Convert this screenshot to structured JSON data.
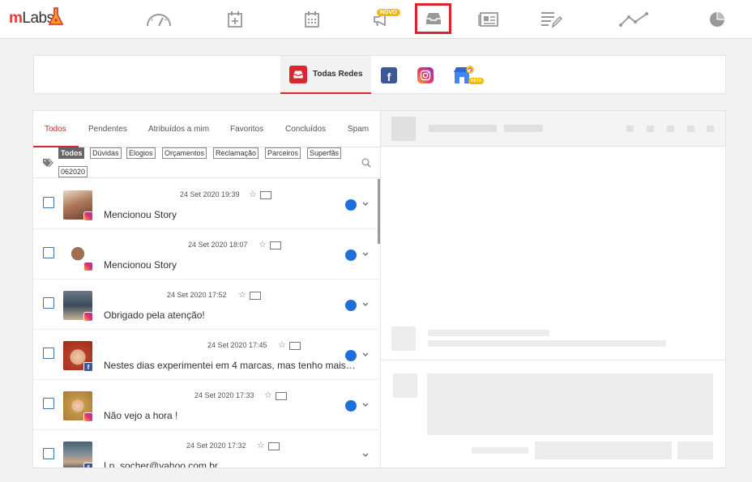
{
  "app": {
    "logo_m": "m",
    "logo_rest": "Labs"
  },
  "topnav": {
    "items": [
      {
        "name": "dashboard",
        "icon": "speedometer-icon"
      },
      {
        "name": "schedule",
        "icon": "calendar-plus-icon"
      },
      {
        "name": "calendar",
        "icon": "calendar-icon"
      },
      {
        "name": "ads",
        "icon": "megaphone-icon",
        "badge": "NOVO"
      },
      {
        "name": "inbox",
        "icon": "inbox-icon",
        "active": true
      },
      {
        "name": "reports",
        "icon": "newspaper-icon"
      },
      {
        "name": "workflow",
        "icon": "checklist-edit-icon"
      },
      {
        "name": "analytics",
        "icon": "line-chart-icon"
      },
      {
        "name": "pie",
        "icon": "pie-chart-icon"
      }
    ]
  },
  "networks": {
    "all_label": "Todas Redes",
    "beta_label": "BETA"
  },
  "tabs": [
    "Todos",
    "Pendentes",
    "Atribuídos a mim",
    "Favoritos",
    "Concluídos",
    "Spam"
  ],
  "filters": [
    "Todos",
    "Dúvidas",
    "Elogios",
    "Orçamentos",
    "Reclamação",
    "Parceiros",
    "Superfãs",
    "062020"
  ],
  "messages": [
    {
      "time": "24 Set 2020 19:39",
      "text": "Mencionou Story",
      "network": "instagram",
      "unread": true
    },
    {
      "time": "24 Set 2020 18:07",
      "text": "Mencionou Story",
      "network": "instagram",
      "unread": true
    },
    {
      "time": "24 Set 2020 17:52",
      "text": "Obrigado pela atenção!",
      "network": "instagram",
      "unread": true
    },
    {
      "time": "24 Set 2020 17:45",
      "text": "Nestes dias experimentei em 4 marcas, mas tenho mais…",
      "network": "facebook",
      "unread": true
    },
    {
      "time": "24 Set 2020 17:33",
      "text": "Não vejo a hora !",
      "network": "instagram",
      "unread": true
    },
    {
      "time": "24 Set 2020 17:32",
      "text": "Lp_socher@yahoo.com.br",
      "network": "facebook",
      "unread": false
    }
  ],
  "colors": {
    "accent": "#d9252f",
    "unread_dot": "#1e6fd9",
    "facebook": "#3b5998"
  }
}
